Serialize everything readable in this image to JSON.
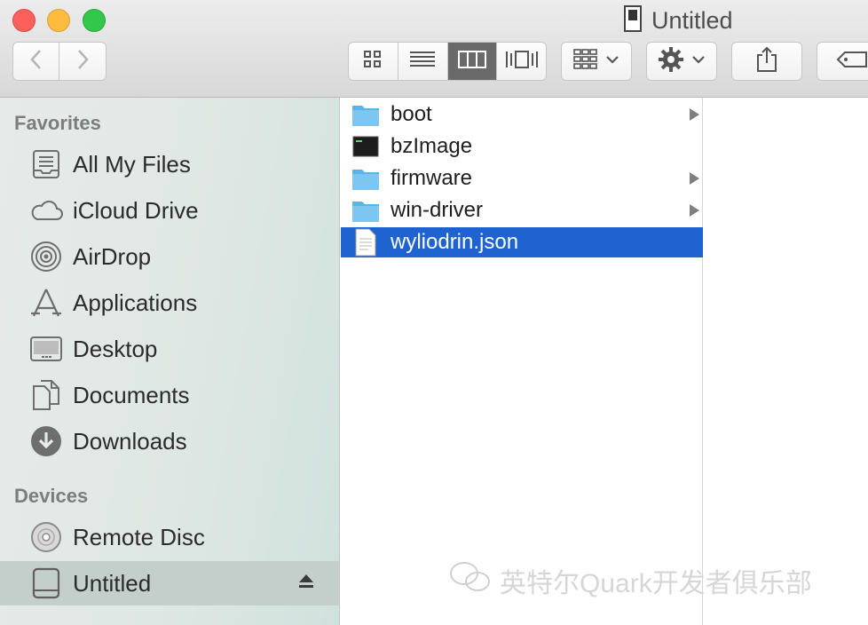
{
  "window": {
    "title": "Untitled"
  },
  "toolbar": {
    "back_icon": "chevron-left-icon",
    "forward_icon": "chevron-right-icon",
    "view_modes": [
      "icon-view-icon",
      "list-view-icon",
      "column-view-icon",
      "cover-flow-icon"
    ],
    "selected_view": "column-view-icon",
    "arrange_icon": "arrange-grid-icon",
    "action_icon": "gear-icon",
    "share_icon": "share-icon",
    "tag_icon": "tag-icon"
  },
  "sidebar": {
    "favorites_header": "Favorites",
    "favorites": [
      {
        "label": "All My Files",
        "icon": "all-files-icon"
      },
      {
        "label": "iCloud Drive",
        "icon": "cloud-icon"
      },
      {
        "label": "AirDrop",
        "icon": "airdrop-icon"
      },
      {
        "label": "Applications",
        "icon": "applications-icon"
      },
      {
        "label": "Desktop",
        "icon": "desktop-icon"
      },
      {
        "label": "Documents",
        "icon": "documents-icon"
      },
      {
        "label": "Downloads",
        "icon": "downloads-icon"
      }
    ],
    "devices_header": "Devices",
    "devices": [
      {
        "label": "Remote Disc",
        "icon": "disc-icon"
      },
      {
        "label": "Untitled",
        "icon": "drive-icon",
        "selected": true
      }
    ]
  },
  "files": [
    {
      "name": "boot",
      "type": "folder",
      "has_children": true
    },
    {
      "name": "bzImage",
      "type": "executable",
      "has_children": false
    },
    {
      "name": "firmware",
      "type": "folder",
      "has_children": true
    },
    {
      "name": "win-driver",
      "type": "folder",
      "has_children": true
    },
    {
      "name": "wyliodrin.json",
      "type": "document",
      "has_children": false,
      "selected": true
    }
  ],
  "watermark": {
    "text": "英特尔Quark开发者俱乐部"
  },
  "colors": {
    "selection": "#1f63d1",
    "folder": "#5ab4ec"
  }
}
